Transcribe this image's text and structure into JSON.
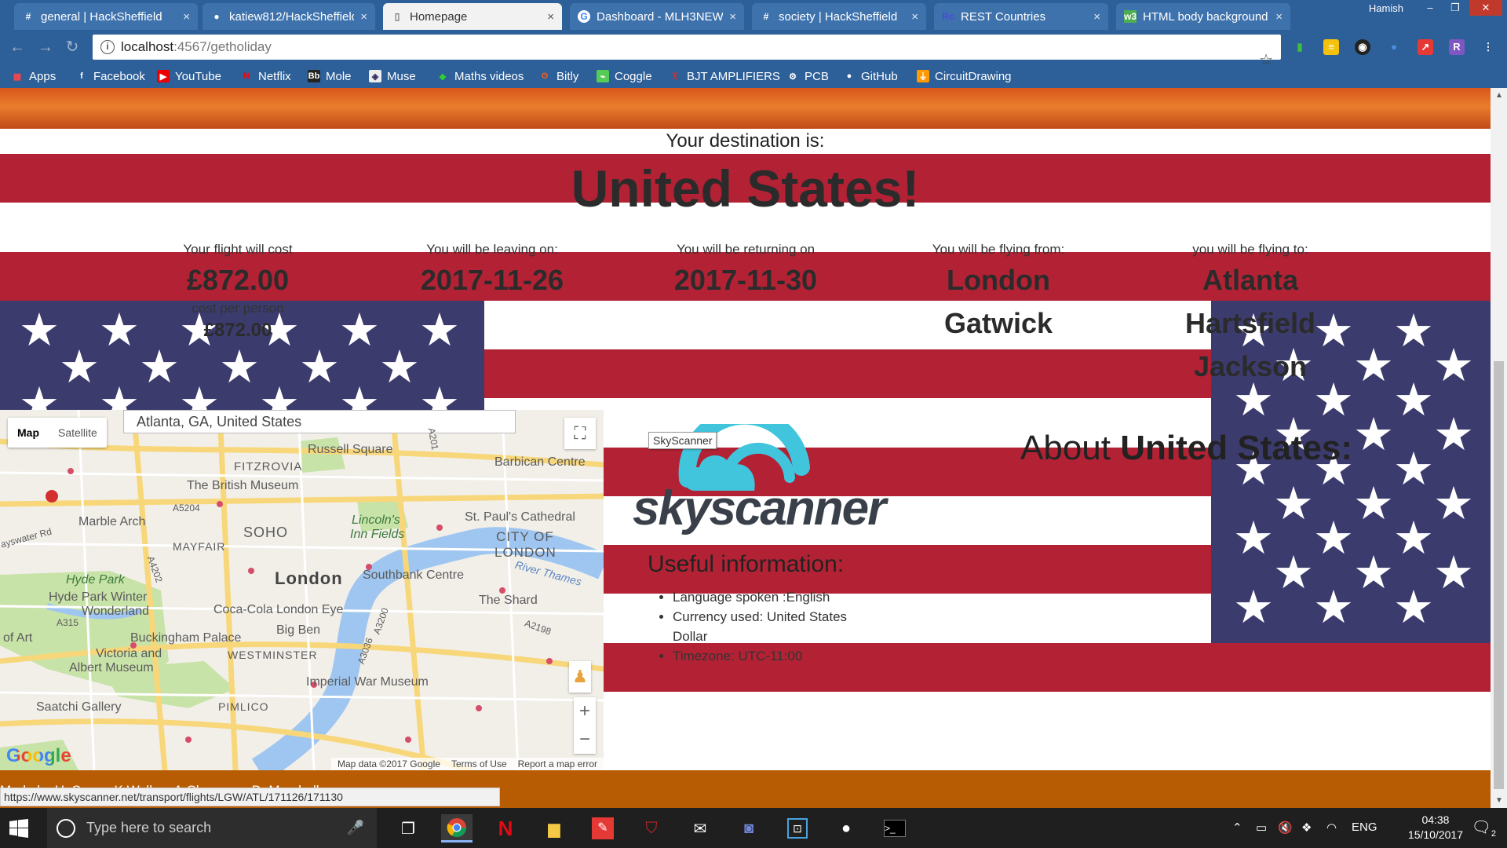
{
  "browser": {
    "profile_name": "Hamish",
    "tabs": [
      {
        "label": "general | HackSheffield",
        "icon": "slack-hash-icon",
        "active": false
      },
      {
        "label": "katiew812/HackSheffield",
        "icon": "github-icon",
        "active": false
      },
      {
        "label": "Homepage",
        "icon": "page-icon",
        "active": true
      },
      {
        "label": "Dashboard - MLH3NEW",
        "icon": "google-icon",
        "active": false
      },
      {
        "label": "society | HackSheffield",
        "icon": "slack-hash-icon",
        "active": false
      },
      {
        "label": "REST Countries",
        "icon": "rc-icon",
        "active": false
      },
      {
        "label": "HTML body background",
        "icon": "w3-icon",
        "active": false
      }
    ],
    "url_host": "localhost",
    "url_path": ":4567/getholiday",
    "bookmarks": [
      {
        "label": "Apps",
        "icon": "apps-grid-icon"
      },
      {
        "label": "Facebook",
        "icon": "facebook-icon"
      },
      {
        "label": "YouTube",
        "icon": "youtube-icon"
      },
      {
        "label": "Netflix",
        "icon": "netflix-icon"
      },
      {
        "label": "Mole",
        "icon": "mole-icon"
      },
      {
        "label": "Muse",
        "icon": "muse-icon"
      },
      {
        "label": "Maths videos",
        "icon": "maths-icon"
      },
      {
        "label": "Bitly",
        "icon": "bitly-icon"
      },
      {
        "label": "Coggle",
        "icon": "coggle-icon"
      },
      {
        "label": "BJT AMPLIFIERS",
        "icon": "bjt-icon"
      },
      {
        "label": "PCB",
        "icon": "gear-icon"
      },
      {
        "label": "GitHub",
        "icon": "github-icon"
      },
      {
        "label": "CircuitDrawing",
        "icon": "circuit-icon"
      }
    ]
  },
  "page": {
    "destination_label": "Your destination is:",
    "destination_country": "United States!",
    "cost": {
      "label": "Your flight will cost",
      "value": "£872.00",
      "sub_label": "cost per person",
      "sub_value": "£872.00"
    },
    "leaving": {
      "label": "You will be leaving on:",
      "value": "2017-11-26"
    },
    "returning": {
      "label": "You will be returning on",
      "value": "2017-11-30"
    },
    "from": {
      "label": "You will be flying from:",
      "value_line1": "London",
      "value_line2": "Gatwick"
    },
    "to": {
      "label": "you will be flying to:",
      "value_line1": "Atlanta",
      "value_line2": "Hartsfield",
      "value_line3": "Jackson"
    },
    "map": {
      "search_value": "Atlanta, GA, United States",
      "tab_map": "Map",
      "tab_satellite": "Satellite",
      "attribution": "Map data ©2017 Google",
      "terms": "Terms of Use",
      "report": "Report a map error",
      "google_logo": "Google",
      "places": {
        "russell_square": "Russell Square",
        "fitzrovia": "FITZROVIA",
        "british_museum": "The British Museum",
        "barbican": "Barbican Centre",
        "marble_arch": "Marble Arch",
        "soho": "SOHO",
        "lincolns": "Lincoln's",
        "inn_fields": "Inn Fields",
        "st_pauls": "St. Paul's Cathedral",
        "city_of": "CITY OF",
        "london_city": "LONDON",
        "mayfair": "MAYFAIR",
        "hyde_park": "Hyde Park",
        "hyde_winter_1": "Hyde Park Winter",
        "hyde_winter_2": "Wonderland",
        "london": "London",
        "southbank": "Southbank Centre",
        "river_thames": "River Thames",
        "the_shard": "The Shard",
        "coca_cola": "Coca-Cola London Eye",
        "big_ben": "Big Ben",
        "buckingham": "Buckingham Palace",
        "westminster": "WESTMINSTER",
        "victoria_1": "Victoria and",
        "victoria_2": "Albert Museum",
        "imperial": "Imperial War Museum",
        "saatchi": "Saatchi Gallery",
        "pimlico": "PIMLICO",
        "of_art": "of Art",
        "a5204": "A5204",
        "a4202": "A4202",
        "a315": "A315",
        "a3036": "A3036",
        "a201": "A201",
        "a3200": "A3200",
        "a2198": "A2198",
        "bayswater": "ayswater Rd"
      }
    },
    "skyscanner_tooltip": "SkyScanner",
    "skyscanner_logo_text": "skyscanner",
    "about_prefix": "About ",
    "about_country": "United States:",
    "useful_title": "Useful information:",
    "useful_items": [
      "Language spoken :English",
      "Currency used: United States Dollar",
      "Timezone: UTC-11:00"
    ],
    "made_by": "Made by H. Soma, K.Walker, A.Chapman, D. Marshall",
    "status_url": "https://www.skyscanner.net/transport/flights/LGW/ATL/171126/171130"
  },
  "taskbar": {
    "search_placeholder": "Type here to search",
    "pinned": [
      "chrome-icon",
      "netflix-icon",
      "file-explorer-icon",
      "pdf-icon",
      "mcafee-icon",
      "mail-icon",
      "discord-icon",
      "app-icon",
      "github-icon",
      "terminal-icon"
    ],
    "language": "ENG",
    "time": "04:38",
    "date": "15/10/2017",
    "notification_count": "2"
  },
  "colors": {
    "flag_red": "#b22234",
    "flag_blue": "#3c3b6e",
    "chrome_blue": "#2d5f98",
    "footer_orange": "#b85c04",
    "skyscanner_cyan": "#40c5dd"
  }
}
